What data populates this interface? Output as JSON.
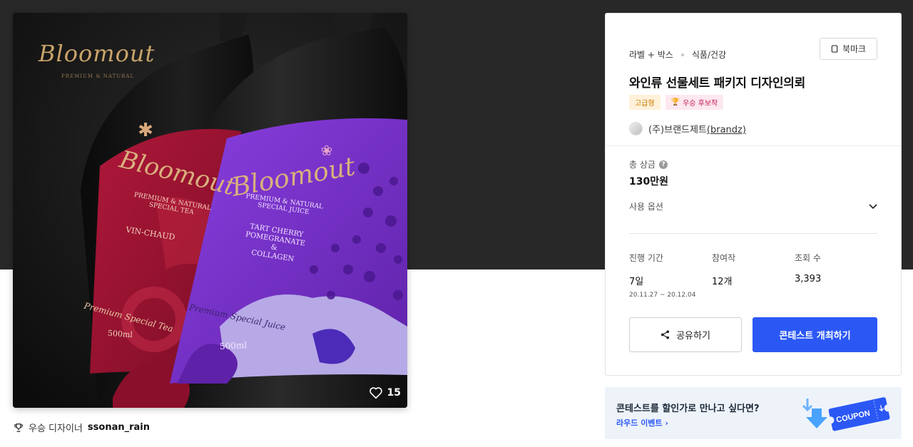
{
  "product_image": {
    "brand_script": "Bloomout",
    "brand_tagline": "PREMIUM & NATURAL",
    "red_label": {
      "brand": "Bloomout",
      "line1": "PREMIUM & NATURAL",
      "line2": "SPECIAL TEA",
      "flavor": "VIN-CHAUD",
      "script": "Premium Special Tea",
      "volume": "500ml"
    },
    "purple_label": {
      "brand": "Bloomout",
      "line1": "PREMIUM & NATURAL",
      "line2": "SPECIAL JUICE",
      "flavor1": "TART CHERRY",
      "flavor2": "POMEGRANATE",
      "flavor3": "&",
      "flavor4": "COLLAGEN",
      "script": "Premium Special Juice",
      "volume": "500ml"
    },
    "likes": "15"
  },
  "winner": {
    "label": "우승 디자이너",
    "name": "ssonan_rain"
  },
  "info": {
    "category_main": "라벨 + 박스",
    "category_sub": "식품/건강",
    "bookmark_label": "북마크",
    "title": "와인류 선물세트 패키지 디자인의뢰",
    "badge_premium": "고급형",
    "badge_winner": "우승 후보작",
    "host_name": "(주)브랜드제트",
    "host_link": "(brandz)",
    "prize_label": "총 상금",
    "prize_value": "130만원",
    "options_label": "사용 옵션",
    "stats": {
      "period_label": "진행 기간",
      "period_value": "7일",
      "period_range": "20.11.27  ~  20.12.04",
      "participants_label": "참여작",
      "participants_value": "12개",
      "views_label": "조회 수",
      "views_value": "3,393"
    },
    "share_label": "공유하기",
    "host_button_label": "콘테스트 개최하기"
  },
  "coupon_banner": {
    "headline": "콘테스트를 할인가로 만나고 싶다면?",
    "link_label": "라우드 이벤트",
    "coupon_text": "COUPON"
  },
  "colors": {
    "accent": "#2b58f5",
    "hero_bg": "#292828",
    "gold": "#c9a46a",
    "red_label": "#9e1230",
    "purple_label": "#7a32c8"
  }
}
